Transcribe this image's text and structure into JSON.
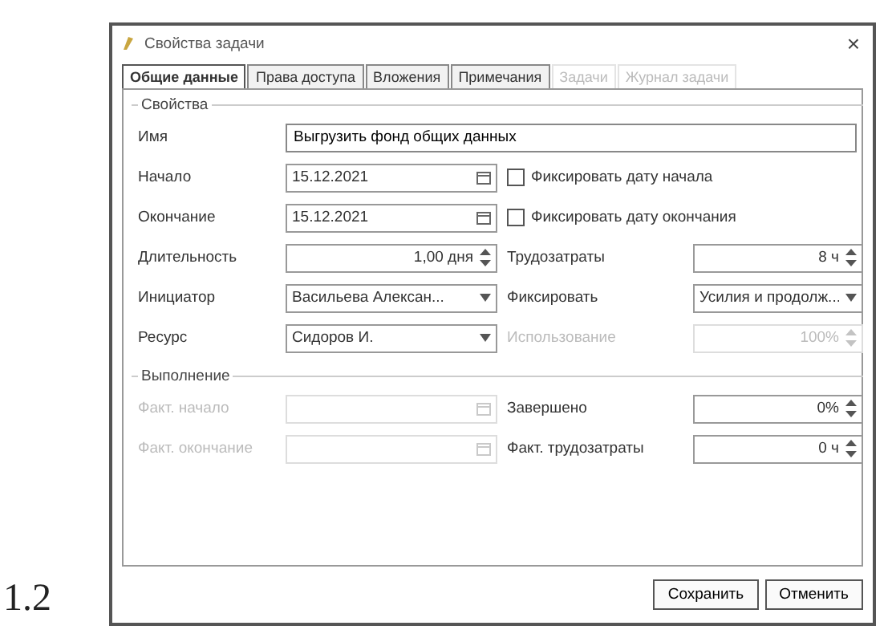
{
  "caption": "1.2",
  "window": {
    "title": "Свойства задачи",
    "close": "×"
  },
  "tabs": [
    {
      "label": "Общие данные",
      "selected": true,
      "disabled": false
    },
    {
      "label": "Права доступа",
      "selected": false,
      "disabled": false
    },
    {
      "label": "Вложения",
      "selected": false,
      "disabled": false
    },
    {
      "label": "Примечания",
      "selected": false,
      "disabled": false
    },
    {
      "label": "Задачи",
      "selected": false,
      "disabled": true
    },
    {
      "label": "Журнал задачи",
      "selected": false,
      "disabled": true
    }
  ],
  "properties": {
    "title": "Свойства",
    "name": {
      "label": "Имя",
      "value": "Выгрузить фонд общих данных"
    },
    "rows": [
      {
        "label": "Начало",
        "field": {
          "kind": "date",
          "value": "15.12.2021",
          "disabled": false
        },
        "right": {
          "kind": "checkbox",
          "label": "Фиксировать дату начала",
          "checked": false
        }
      },
      {
        "label": "Окончание",
        "field": {
          "kind": "date",
          "value": "15.12.2021",
          "disabled": false
        },
        "right": {
          "kind": "checkbox",
          "label": "Фиксировать дату окончания",
          "checked": false
        }
      },
      {
        "label": "Длительность",
        "field": {
          "kind": "spin",
          "value": "1,00 дня",
          "disabled": false
        },
        "right": {
          "kind": "labeled",
          "label": "Трудозатраты",
          "field": {
            "kind": "spin",
            "value": "8 ч",
            "disabled": false
          }
        }
      },
      {
        "label": "Инициатор",
        "field": {
          "kind": "combo",
          "value": "Васильева Алексан...",
          "disabled": false
        },
        "right": {
          "kind": "labeled",
          "label": "Фиксировать",
          "field": {
            "kind": "combo",
            "value": "Усилия и продолж...",
            "disabled": false
          }
        }
      },
      {
        "label": "Ресурс",
        "field": {
          "kind": "combo",
          "value": "Сидоров И.",
          "disabled": false
        },
        "right": {
          "kind": "labeled",
          "label": "Использование",
          "field": {
            "kind": "spin",
            "value": "100%",
            "disabled": true
          }
        }
      }
    ]
  },
  "execution": {
    "title": "Выполнение",
    "rows": [
      {
        "label": "Факт. начало",
        "field": {
          "kind": "date",
          "disabled": true
        },
        "right": {
          "kind": "labeled",
          "label": "Завершено",
          "field": {
            "kind": "spin",
            "value": "0%",
            "disabled": false
          }
        }
      },
      {
        "label": "Факт. окончание",
        "field": {
          "kind": "date",
          "disabled": true
        },
        "right": {
          "kind": "labeled",
          "label": "Факт. трудозатраты",
          "field": {
            "kind": "spin",
            "value": "0 ч",
            "disabled": false
          }
        }
      }
    ]
  },
  "buttons": [
    "Сохранить",
    "Отменить"
  ]
}
